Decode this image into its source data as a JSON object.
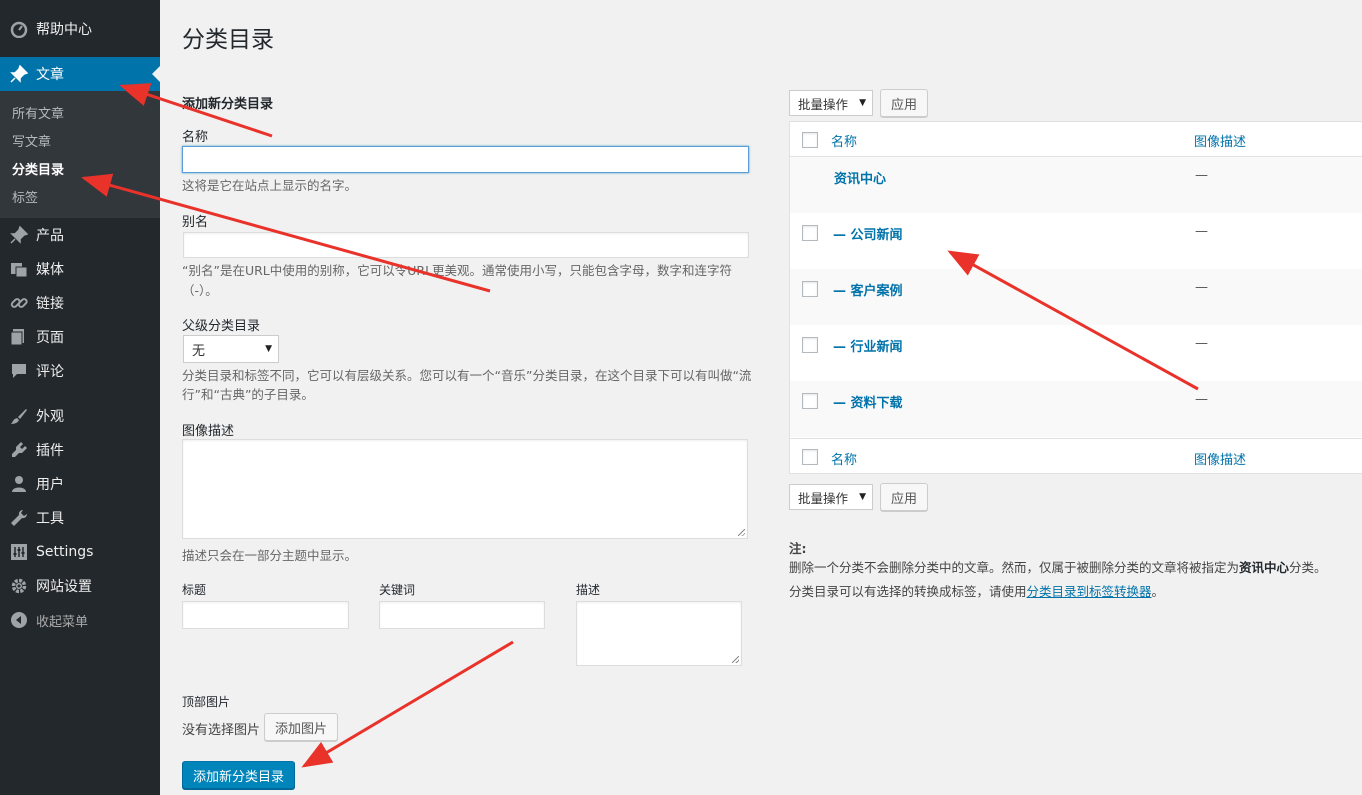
{
  "sidebar": {
    "items": [
      {
        "label": "帮助中心",
        "icon": "dashboard-icon",
        "active": false
      },
      {
        "label": "文章",
        "icon": "pin-icon",
        "active": true
      },
      {
        "label": "产品",
        "icon": "pin-icon",
        "active": false
      },
      {
        "label": "媒体",
        "icon": "media-icon",
        "active": false
      },
      {
        "label": "链接",
        "icon": "link-icon",
        "active": false
      },
      {
        "label": "页面",
        "icon": "page-icon",
        "active": false
      },
      {
        "label": "评论",
        "icon": "comment-icon",
        "active": false
      },
      {
        "label": "外观",
        "icon": "brush-icon",
        "active": false
      },
      {
        "label": "插件",
        "icon": "plugin-icon",
        "active": false
      },
      {
        "label": "用户",
        "icon": "user-icon",
        "active": false
      },
      {
        "label": "工具",
        "icon": "wrench-icon",
        "active": false
      },
      {
        "label": "Settings",
        "icon": "settings-icon",
        "active": false
      },
      {
        "label": "网站设置",
        "icon": "gear-icon",
        "active": false
      }
    ],
    "submenu": [
      {
        "label": "所有文章",
        "current": false
      },
      {
        "label": "写文章",
        "current": false
      },
      {
        "label": "分类目录",
        "current": true
      },
      {
        "label": "标签",
        "current": false
      }
    ],
    "collapse_label": "收起菜单"
  },
  "page": {
    "title": "分类目录"
  },
  "form": {
    "heading": "添加新分类目录",
    "name_label": "名称",
    "name_value": "",
    "name_help": "这将是它在站点上显示的名字。",
    "slug_label": "别名",
    "slug_value": "",
    "slug_help_line1": "“别名”是在URL中使用的别称，它可以令URL更美观。通常使用小写，只能包含字母，数字和连字符",
    "slug_help_line2": "（-）。",
    "parent_label": "父级分类目录",
    "parent_selected": "无",
    "parent_help_line1": "分类目录和标签不同，它可以有层级关系。您可以有一个“音乐”分类目录，在这个目录下可以有叫做“流",
    "parent_help_line2": "行”和“古典”的子目录。",
    "desc_label": "图像描述",
    "desc_help": "描述只会在一部分主题中显示。",
    "seo_title_label": "标题",
    "seo_keywords_label": "关键词",
    "seo_desc_label": "描述",
    "top_image_label": "顶部图片",
    "no_image_text": "没有选择图片",
    "add_image_button": "添加图片",
    "submit_button": "添加新分类目录"
  },
  "list": {
    "bulk_action": "批量操作",
    "apply_button": "应用",
    "col_name": "名称",
    "col_desc": "图像描述",
    "rows": [
      {
        "name": "资讯中心",
        "desc": "—",
        "checkbox": false
      },
      {
        "name": "— 公司新闻",
        "desc": "—",
        "checkbox": true
      },
      {
        "name": "— 客户案例",
        "desc": "—",
        "checkbox": true
      },
      {
        "name": "— 行业新闻",
        "desc": "—",
        "checkbox": true
      },
      {
        "name": "— 资料下载",
        "desc": "—",
        "checkbox": true
      }
    ],
    "note_title": "注:",
    "note_line1_pre": "删除一个分类不会删除分类中的文章。然而，仅属于被删除分类的文章将被指定为",
    "note_line1_bold": "资讯中心",
    "note_line1_post": "分类。",
    "note_line2_pre": "分类目录可以有选择的转换成标签，请使用",
    "note_line2_link": "分类目录到标签转换器",
    "note_line2_post": "。"
  },
  "colors": {
    "sidebar": "#23282d",
    "submenu": "#32373c",
    "accent": "#0073aa",
    "arrow": "#e8322a"
  }
}
